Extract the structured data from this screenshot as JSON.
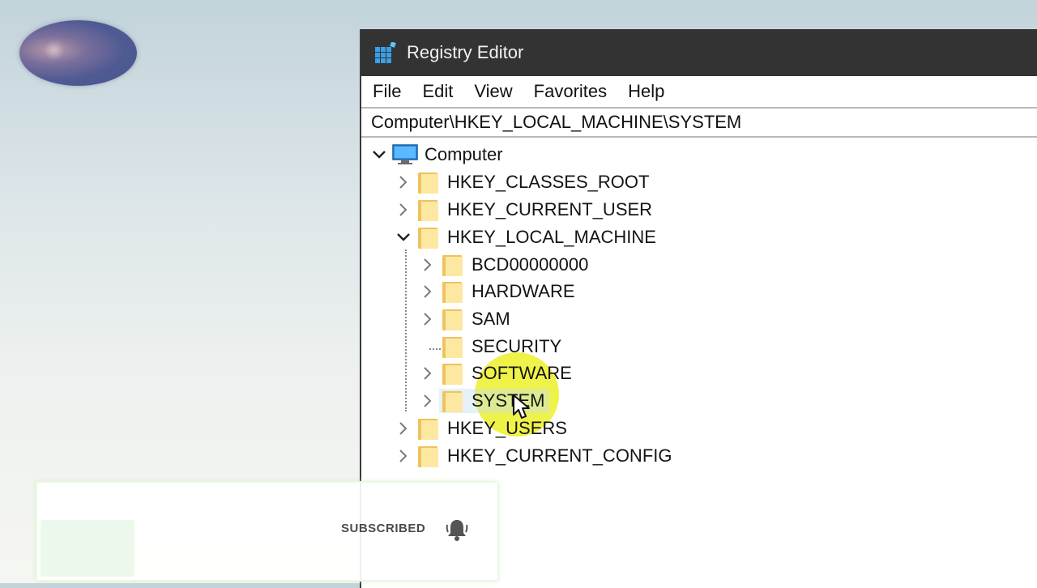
{
  "window": {
    "title": "Registry Editor",
    "icon": "registry-editor-icon"
  },
  "menu": [
    "File",
    "Edit",
    "View",
    "Favorites",
    "Help"
  ],
  "address": "Computer\\HKEY_LOCAL_MACHINE\\SYSTEM",
  "tree": {
    "root": "Computer",
    "hives": [
      "HKEY_CLASSES_ROOT",
      "HKEY_CURRENT_USER",
      "HKEY_LOCAL_MACHINE",
      "HKEY_USERS",
      "HKEY_CURRENT_CONFIG"
    ],
    "hklm_children": [
      "BCD00000000",
      "HARDWARE",
      "SAM",
      "SECURITY",
      "SOFTWARE",
      "SYSTEM"
    ],
    "selected": "SYSTEM"
  },
  "overlay": {
    "subscribed_label": "SUBSCRIBED",
    "bell_icon": "bell-icon"
  },
  "colors": {
    "titlebar": "#333333",
    "folder": "#f0c25a",
    "highlight": "#ecf028",
    "selection": "#cce8ff"
  }
}
